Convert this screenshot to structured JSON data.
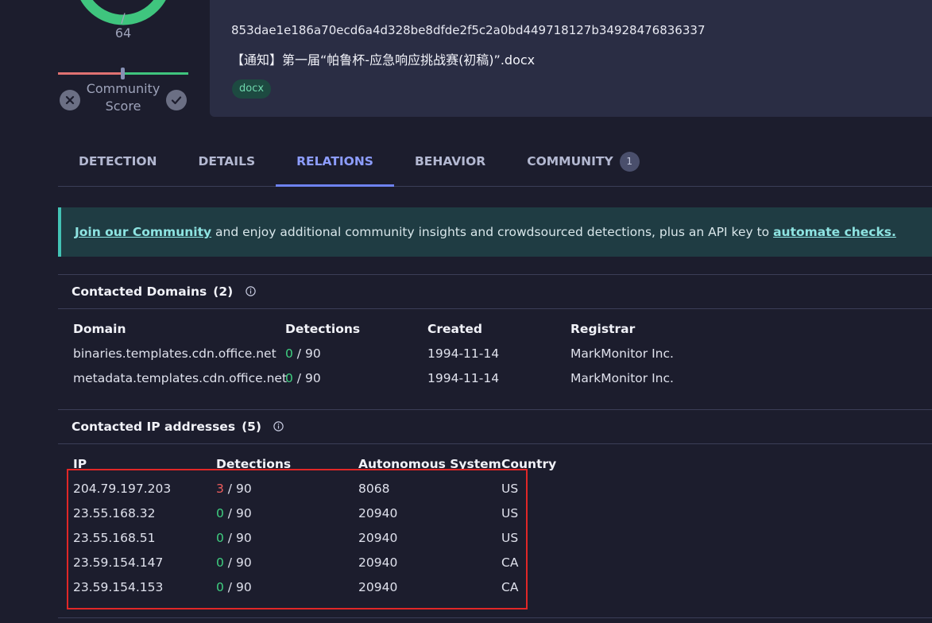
{
  "score": {
    "total_label": "/ 64",
    "community_score_label": "Community\nScore",
    "ring_color": "#3fc57e"
  },
  "file": {
    "hash": "853dae1e186a70ecd6a4d328be8dfde2f5c2a0bd449718127b34928476836337",
    "name": "【通知】第一届“帕鲁杯-应急响应挑战赛(初稿)”.docx",
    "tag": "docx"
  },
  "tabs": [
    {
      "label": "DETECTION"
    },
    {
      "label": "DETAILS"
    },
    {
      "label": "RELATIONS"
    },
    {
      "label": "BEHAVIOR"
    },
    {
      "label": "COMMUNITY",
      "badge": "1"
    }
  ],
  "banner": {
    "link1": "Join our Community",
    "middle": " and enjoy additional community insights and crowdsourced detections, plus an API key to ",
    "link2": "automate checks."
  },
  "domains": {
    "title": "Contacted Domains",
    "count": "(2)",
    "columns": [
      "Domain",
      "Detections",
      "Created",
      "Registrar"
    ],
    "rows": [
      {
        "domain": "binaries.templates.cdn.office.net",
        "detections": "0",
        "total": " / 90",
        "created": "1994-11-14",
        "registrar": "MarkMonitor Inc."
      },
      {
        "domain": "metadata.templates.cdn.office.net",
        "detections": "0",
        "total": " / 90",
        "created": "1994-11-14",
        "registrar": "MarkMonitor Inc."
      }
    ]
  },
  "ips": {
    "title": "Contacted IP addresses",
    "count": "(5)",
    "columns": [
      "IP",
      "Detections",
      "Autonomous System",
      "Country"
    ],
    "rows": [
      {
        "ip": "204.79.197.203",
        "detections": "3",
        "total": " / 90",
        "asn": "8068",
        "country": "US"
      },
      {
        "ip": "23.55.168.32",
        "detections": "0",
        "total": " / 90",
        "asn": "20940",
        "country": "US"
      },
      {
        "ip": "23.55.168.51",
        "detections": "0",
        "total": " / 90",
        "asn": "20940",
        "country": "US"
      },
      {
        "ip": "23.59.154.147",
        "detections": "0",
        "total": " / 90",
        "asn": "20940",
        "country": "CA"
      },
      {
        "ip": "23.59.154.153",
        "detections": "0",
        "total": " / 90",
        "asn": "20940",
        "country": "CA"
      }
    ]
  }
}
